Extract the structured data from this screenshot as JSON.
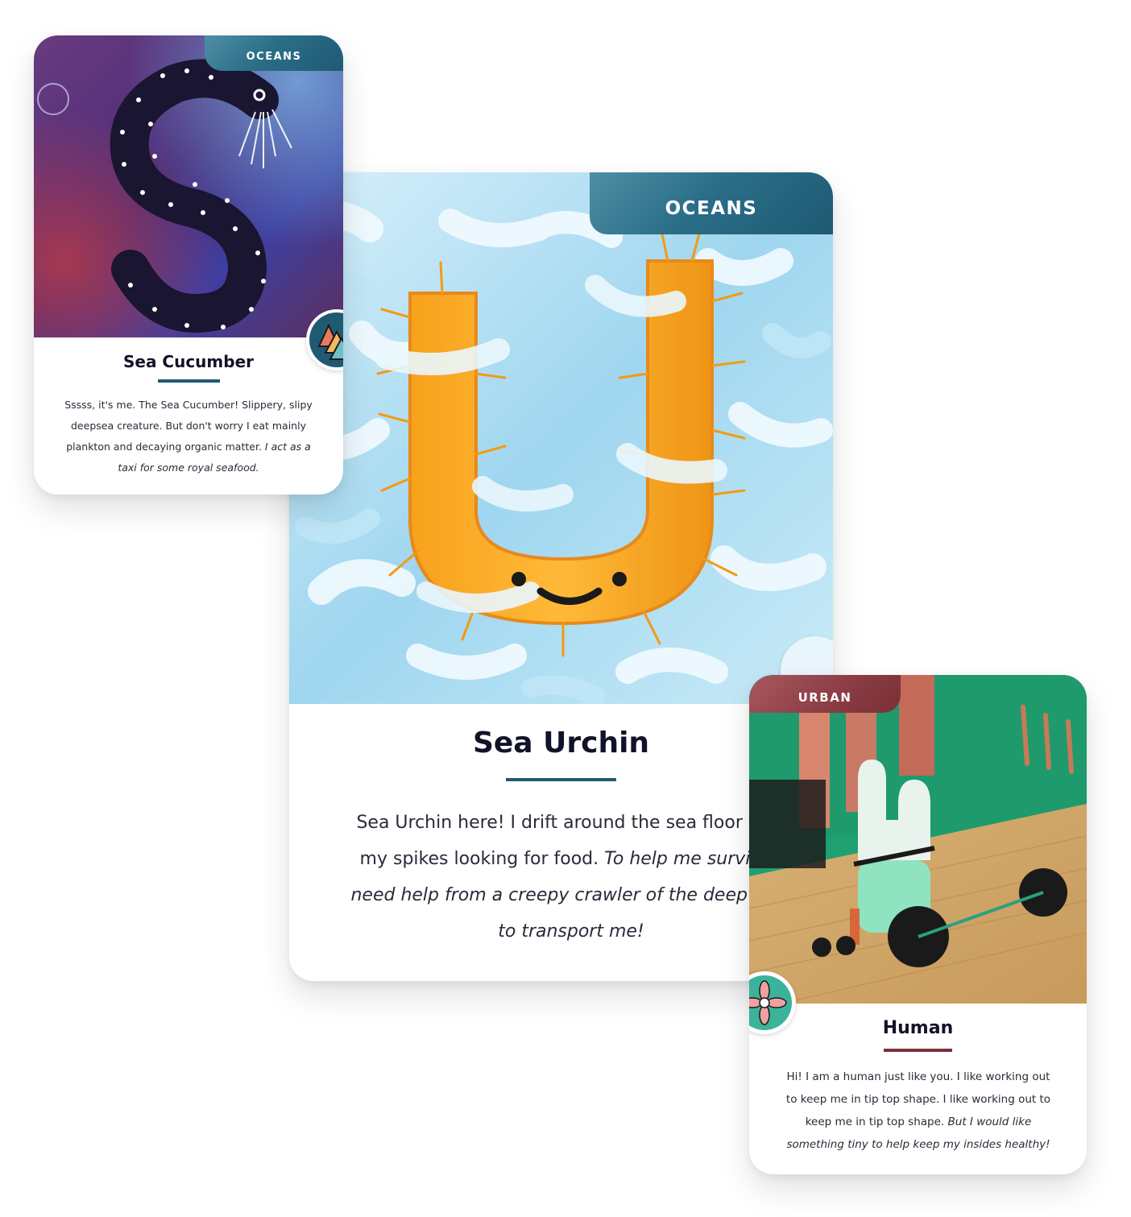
{
  "cards": {
    "sea_cucumber": {
      "tag": "OCEANS",
      "title": "Sea Cucumber",
      "desc_plain": "Sssss, it's me. The Sea Cucumber! Slippery, slipy deepsea creature. But don't worry I eat mainly plankton and decaying organic matter.",
      "desc_italic": "I act as a taxi for some royal seafood.",
      "accent": "#1f5a73"
    },
    "sea_urchin": {
      "tag": "OCEANS",
      "title": "Sea Urchin",
      "desc_plain": "Sea Urchin here! I drift around the sea floor with my spikes looking for food.",
      "desc_italic": "To help me survive I need help from a creepy crawler of the deep blue to transport me!",
      "accent": "#1f5a73"
    },
    "human": {
      "tag": "URBAN",
      "title": "Human",
      "desc_plain": "Hi! I am a human just like you. I like working out to keep me in tip top shape. I like working out to keep me in tip top shape.",
      "desc_italic": "But I would like something tiny to help keep my insides healthy!",
      "accent": "#7a3038"
    }
  },
  "icons": {
    "ocean_badge": "ocean-triangles-icon",
    "urban_badge": "flower-icon"
  }
}
